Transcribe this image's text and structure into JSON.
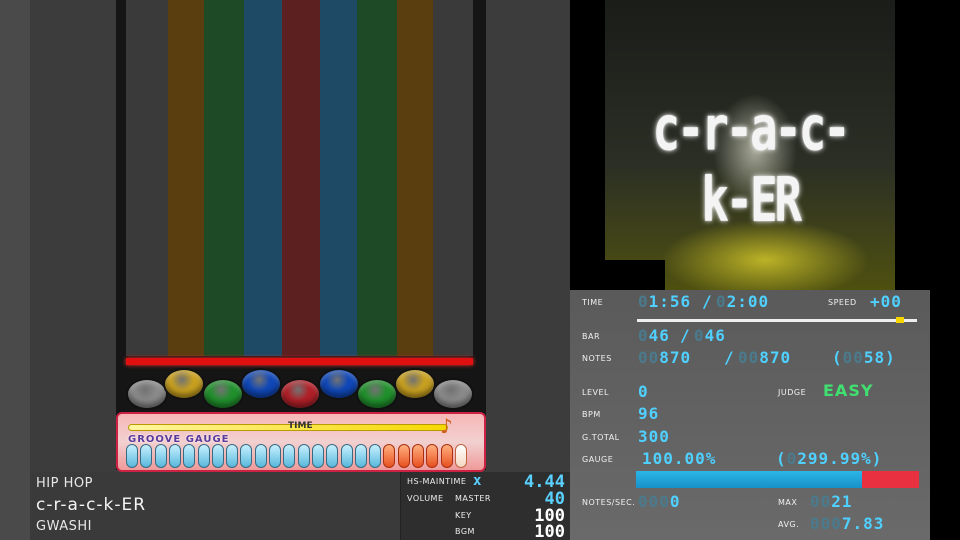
{
  "lanes": [
    {
      "color": "#3a3a3a"
    },
    {
      "color": "#5a3e10"
    },
    {
      "color": "#1e4a26"
    },
    {
      "color": "#1f4a66"
    },
    {
      "color": "#5c2020"
    },
    {
      "color": "#1f4a66"
    },
    {
      "color": "#1e4a26"
    },
    {
      "color": "#5a3e10"
    },
    {
      "color": "#3a3a3a"
    }
  ],
  "buttons": [
    {
      "color": "#8a8a8a"
    },
    {
      "color": "#c8a020"
    },
    {
      "color": "#20902c"
    },
    {
      "color": "#1048b8"
    },
    {
      "color": "#b02028"
    },
    {
      "color": "#1048b8"
    },
    {
      "color": "#20902c"
    },
    {
      "color": "#c8a020"
    },
    {
      "color": "#8a8a8a"
    }
  ],
  "gauge_panel": {
    "time_label": "TIME",
    "groove_label": "GROOVE GAUGE",
    "segments_total": 24,
    "segments_red": 6
  },
  "song": {
    "genre": "HIP HOP",
    "title": "c-r-a-c-k-ER",
    "artist": "GWASHI"
  },
  "settings": {
    "hs_label": "HS-MAINTIME",
    "hs_x": "x",
    "hs_value": "4.44",
    "volume_label": "VOLUME",
    "master_label": "MASTER",
    "master_value": "40",
    "key_label": "KEY",
    "key_value": "100",
    "bgm_label": "BGM",
    "bgm_value": "100"
  },
  "movie": {
    "title_text": "c-r-a-c-k-ER"
  },
  "stats": {
    "time_label": "TIME",
    "time_current": "1:56",
    "time_sep": "/",
    "time_total": "2:00",
    "speed_label": "SPEED",
    "speed_value": "+00",
    "speed_fraction": 0.94,
    "bar_label": "BAR",
    "bar_current": "46",
    "bar_sep": "/",
    "bar_total": "46",
    "notes_label": "NOTES",
    "notes_current": "870",
    "notes_sep": "/",
    "notes_total": "870",
    "notes_extra": "58",
    "level_label": "LEVEL",
    "level_value": "0",
    "judge_label": "JUDGE",
    "judge_value": "EASY",
    "bpm_label": "BPM",
    "bpm_value": "96",
    "gtotal_label": "G.TOTAL",
    "gtotal_value": "300",
    "gauge_label": "GAUGE",
    "gauge_value": "100.00%",
    "gauge_extra": "299.99%",
    "gauge_fraction": 0.8,
    "nps_label": "NOTES/SEC.",
    "nps_value": "0",
    "max_label": "MAX",
    "max_value": "21",
    "avg_label": "AVG.",
    "avg_value": "7.83"
  }
}
